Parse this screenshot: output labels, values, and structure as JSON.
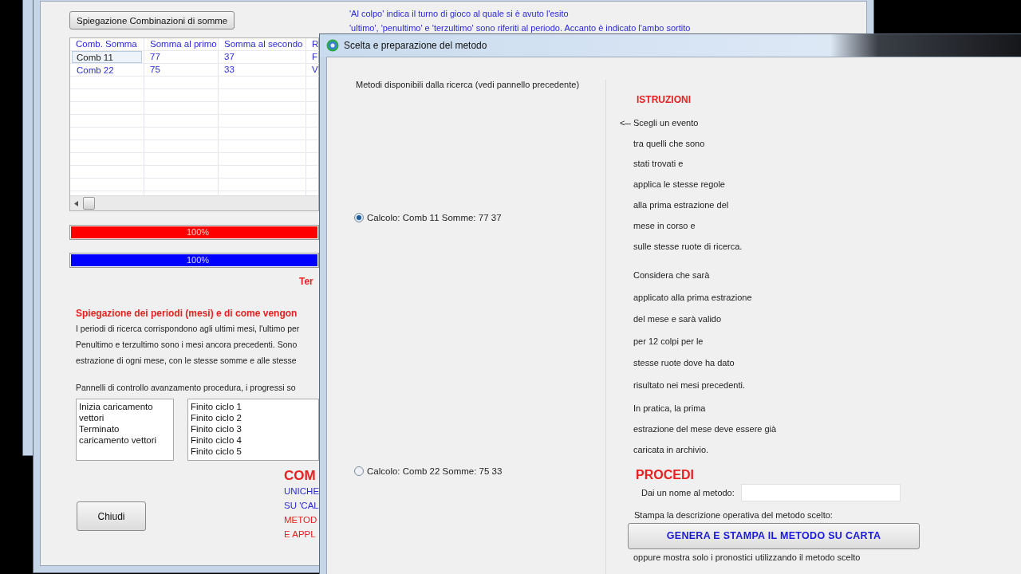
{
  "back_window": {
    "explain_button": "Spiegazione Combinazioni di somme",
    "notes": [
      "'Al colpo' indica il turno di gioco al quale si è avuto l'esito",
      "'ultimo', 'penultimo' e 'terzultimo' sono riferiti al periodo. Accanto è indicato l'ambo sortito"
    ],
    "table": {
      "columns": [
        "Comb. Somma",
        "Somma al primo",
        "Somma al secondo",
        "R"
      ],
      "rows": [
        {
          "cells": [
            "Comb 11",
            "77",
            "37",
            "F"
          ],
          "selected": true
        },
        {
          "cells": [
            "Comb 22",
            "75",
            "33",
            "V"
          ],
          "selected": false
        }
      ]
    },
    "progress_bars": [
      {
        "label": "100%",
        "level": 1,
        "color": "#ff0000"
      },
      {
        "label": "100%",
        "level": 1,
        "color": "#0000ff"
      }
    ],
    "status": "Ter",
    "periods_heading": "Spiegazione dei periodi (mesi) e di come vengon",
    "periods_text": [
      "I periodi di ricerca corrispondono agli ultimi mesi, l'ultimo per",
      "Penultimo e terzultimo sono i mesi ancora precedenti.  Sono",
      "estrazione di ogni mese, con le stesse somme e alle stesse"
    ],
    "panels_caption": "Pannelli di controllo avanzamento procedura, i progressi so",
    "log_lists": [
      [
        "Inizia caricamento vettori",
        "Terminato caricamento vettori"
      ],
      [
        "Finito ciclo 1",
        "Finito ciclo 2",
        "Finito ciclo 3",
        "Finito ciclo 4",
        "Finito ciclo 5"
      ]
    ],
    "comb_title": "COM",
    "comb_lines": [
      {
        "text": "UNICHE",
        "color": "#2a2ad8"
      },
      {
        "text": "SU 'CAL",
        "color": "#2a2ad8"
      },
      {
        "text": "METOD",
        "color": "#e82020"
      },
      {
        "text": "E APPL",
        "color": "#e82020"
      }
    ],
    "close_button": "Chiudi"
  },
  "method_window": {
    "title": "Scelta e preparazione del metodo",
    "methods_caption": "Metodi disponibili dalla ricerca (vedi pannello precedente)",
    "methods": [
      {
        "label": "Calcolo: Comb 11 Somme: 77 37",
        "selected": true
      },
      {
        "label": "Calcolo: Comb 22 Somme: 75 33",
        "selected": false
      }
    ],
    "instructions_title": "ISTRUZIONI",
    "pointer": "<---",
    "instruction_groups": [
      [
        "Scegli un  evento",
        "tra quelli che sono",
        "stati trovati e",
        "applica le stesse regole",
        "alla prima estrazione del",
        "mese in corso e",
        "sulle stesse ruote di ricerca."
      ],
      [
        "Considera che sarà",
        "applicato alla prima estrazione",
        "del mese e sarà valido",
        "per 12 colpi per le",
        "stesse ruote dove ha dato",
        "risultato nei mesi precedenti."
      ],
      [
        "In pratica, la prima",
        "estrazione del mese deve essere già",
        "caricata in archivio."
      ]
    ],
    "proceed_title": "PROCEDI",
    "name_label": "Dai un nome al metodo:",
    "print_label": "Stampa la descrizione operativa del metodo scelto:",
    "print_button": "GENERA E STAMPA IL METODO SU CARTA",
    "alt_label": "oppure mostra solo i pronostici utilizzando il metodo scelto"
  }
}
